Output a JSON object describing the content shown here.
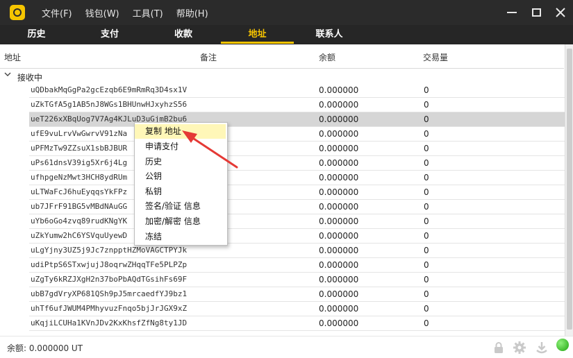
{
  "window": {
    "menu": [
      "文件(F)",
      "钱包(W)",
      "工具(T)",
      "帮助(H)"
    ]
  },
  "tabs": [
    {
      "label": "历史",
      "active": false
    },
    {
      "label": "支付",
      "active": false
    },
    {
      "label": "收款",
      "active": false
    },
    {
      "label": "地址",
      "active": true
    },
    {
      "label": "联系人",
      "active": false
    }
  ],
  "columns": {
    "address": "地址",
    "note": "备注",
    "balance": "余额",
    "tx_count": "交易量"
  },
  "group": {
    "label": "接收中",
    "expanded": true
  },
  "rows": [
    {
      "address": "uQDbakMqGgPa2gcEzqb6E9mRmRq3D4sx1V",
      "balance": "0.000000",
      "tx": "0"
    },
    {
      "address": "uZkTGfA5g1AB5nJ8WGs1BHUnwHJxyhzS56",
      "balance": "0.000000",
      "tx": "0"
    },
    {
      "address": "ueT226xXBqUog7V7Ag4KJLuD3uGjmB2bu6",
      "balance": "0.000000",
      "tx": "0",
      "selected": true
    },
    {
      "address": "ufE9vuLrvVwGwrvV91zNa",
      "balance": "0.000000",
      "tx": "0"
    },
    {
      "address": "uPFMzTw9ZZsuX1sbBJBUR",
      "balance": "0.000000",
      "tx": "0"
    },
    {
      "address": "uPs61dnsV39ig5Xr6j4Lg",
      "balance": "0.000000",
      "tx": "0"
    },
    {
      "address": "ufhpgeNzMwt3HCH8ydRUm",
      "balance": "0.000000",
      "tx": "0"
    },
    {
      "address": "uLTWaFcJ6huEyqqsYkFPz",
      "balance": "0.000000",
      "tx": "0"
    },
    {
      "address": "ub7JFrF91BG5vMBdNAuGG",
      "balance": "0.000000",
      "tx": "0"
    },
    {
      "address": "uYb6oGo4zvq89rudKNgYK",
      "balance": "0.000000",
      "tx": "0"
    },
    {
      "address": "uZkYumw2hC6YSVquUyewD",
      "balance": "0.000000",
      "tx": "0"
    },
    {
      "address": "uLgYjny3UZ5j9Jc7znpptHZMoVAGCTPYJk",
      "balance": "0.000000",
      "tx": "0"
    },
    {
      "address": "udiPtpS6STxwjujJ8oqrwZHqqTFe5PLPZp",
      "balance": "0.000000",
      "tx": "0"
    },
    {
      "address": "uZgTy6kRZJXgH2n37boPbAQdTGsihFs69F",
      "balance": "0.000000",
      "tx": "0"
    },
    {
      "address": "ubB7gdVryXP681QSh9pJ5mrcaedfYJ9bz1",
      "balance": "0.000000",
      "tx": "0"
    },
    {
      "address": "uhTf6ufJWUM4PMhyvuzFnqo5bjJrJGX9xZ",
      "balance": "0.000000",
      "tx": "0"
    },
    {
      "address": "uKqjiLCUHa1KVnJDv2KxKhsfZfNg8ty1JD",
      "balance": "0.000000",
      "tx": "0"
    }
  ],
  "context_menu": {
    "items": [
      "复制 地址",
      "申请支付",
      "历史",
      "公钥",
      "私钥",
      "签名/验证 信息",
      "加密/解密 信息",
      "冻结"
    ],
    "hovered_index": 0
  },
  "status": {
    "balance_text": "余额: 0.000000 UT"
  },
  "colors": {
    "accent": "#f7c400",
    "titlebar": "#2b2b2b",
    "tabbar": "#262626",
    "arrow": "#e53935",
    "online": "#2fb81e"
  },
  "icons": [
    "wallet-logo-icon",
    "minimize-icon",
    "maximize-icon",
    "close-icon",
    "chevron-down-icon",
    "lock-icon",
    "gear-icon",
    "download-icon",
    "connection-status-icon"
  ]
}
